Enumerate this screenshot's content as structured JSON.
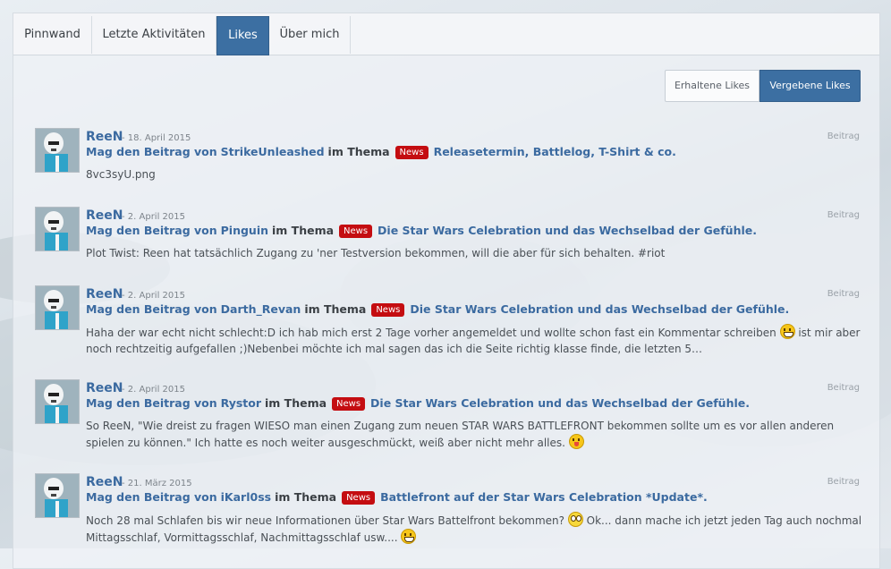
{
  "tabs": [
    {
      "label": "Pinnwand"
    },
    {
      "label": "Letzte Aktivitäten"
    },
    {
      "label": "Likes"
    },
    {
      "label": "Über mich"
    }
  ],
  "toggle": {
    "received_label": "Erhaltene Likes",
    "given_label": "Vergebene Likes"
  },
  "items": [
    {
      "user": "ReeN",
      "date": "- 18. April 2015",
      "prefix": "Mag den Beitrag von",
      "author": "StrikeUnleashed",
      "mid": "im Thema",
      "badge": "News",
      "thread": "Releasetermin, Battlelog, T-Shirt & co.",
      "type": "Beitrag",
      "text1": "8vc3syU.png"
    },
    {
      "user": "ReeN",
      "date": "- 2. April 2015",
      "prefix": "Mag den Beitrag von",
      "author": "Pinguin",
      "mid": "im Thema",
      "badge": "News",
      "thread": "Die Star Wars Celebration und das Wechselbad der Gefühle.",
      "type": "Beitrag",
      "text1": "Plot Twist: Reen hat tatsächlich Zugang zu 'ner Testversion bekommen, will die aber für sich behalten. #riot"
    },
    {
      "user": "ReeN",
      "date": "- 2. April 2015",
      "prefix": "Mag den Beitrag von",
      "author": "Darth_Revan",
      "mid": "im Thema",
      "badge": "News",
      "thread": "Die Star Wars Celebration und das Wechselbad der Gefühle.",
      "type": "Beitrag",
      "text1": "Haha der war echt nicht schlecht:D ich hab mich erst 2 Tage vorher angemeldet und wollte schon fast ein Kommentar schreiben ",
      "text2": " ist mir aber noch rechtzeitig aufgefallen ;)Nebenbei möchte ich mal sagen das ich die Seite richtig klasse finde, die letzten 5…"
    },
    {
      "user": "ReeN",
      "date": "- 2. April 2015",
      "prefix": "Mag den Beitrag von",
      "author": "Rystor",
      "mid": "im Thema",
      "badge": "News",
      "thread": "Die Star Wars Celebration und das Wechselbad der Gefühle.",
      "type": "Beitrag",
      "text1": "So ReeN, \"Wie dreist zu fragen WIESO man einen Zugang zum neuen STAR WARS BATTLEFRONT bekommen sollte um es vor allen anderen spielen zu können.\" Ich hatte es noch weiter ausgeschmückt, weiß aber nicht mehr alles. "
    },
    {
      "user": "ReeN",
      "date": "- 21. März 2015",
      "prefix": "Mag den Beitrag von",
      "author": "iKarl0ss",
      "mid": "im Thema",
      "badge": "News",
      "thread": "Battlefront auf der Star Wars Celebration *Update*.",
      "type": "Beitrag",
      "text1": "Noch 28 mal Schlafen bis wir neue Informationen über Star Wars Battelfront bekommen? ",
      "text2": " Ok... dann mache ich jetzt jeden Tag auch nochmal Mittagsschlaf, Vormittagsschlaf, Nachmittagsschlaf usw.... "
    }
  ]
}
